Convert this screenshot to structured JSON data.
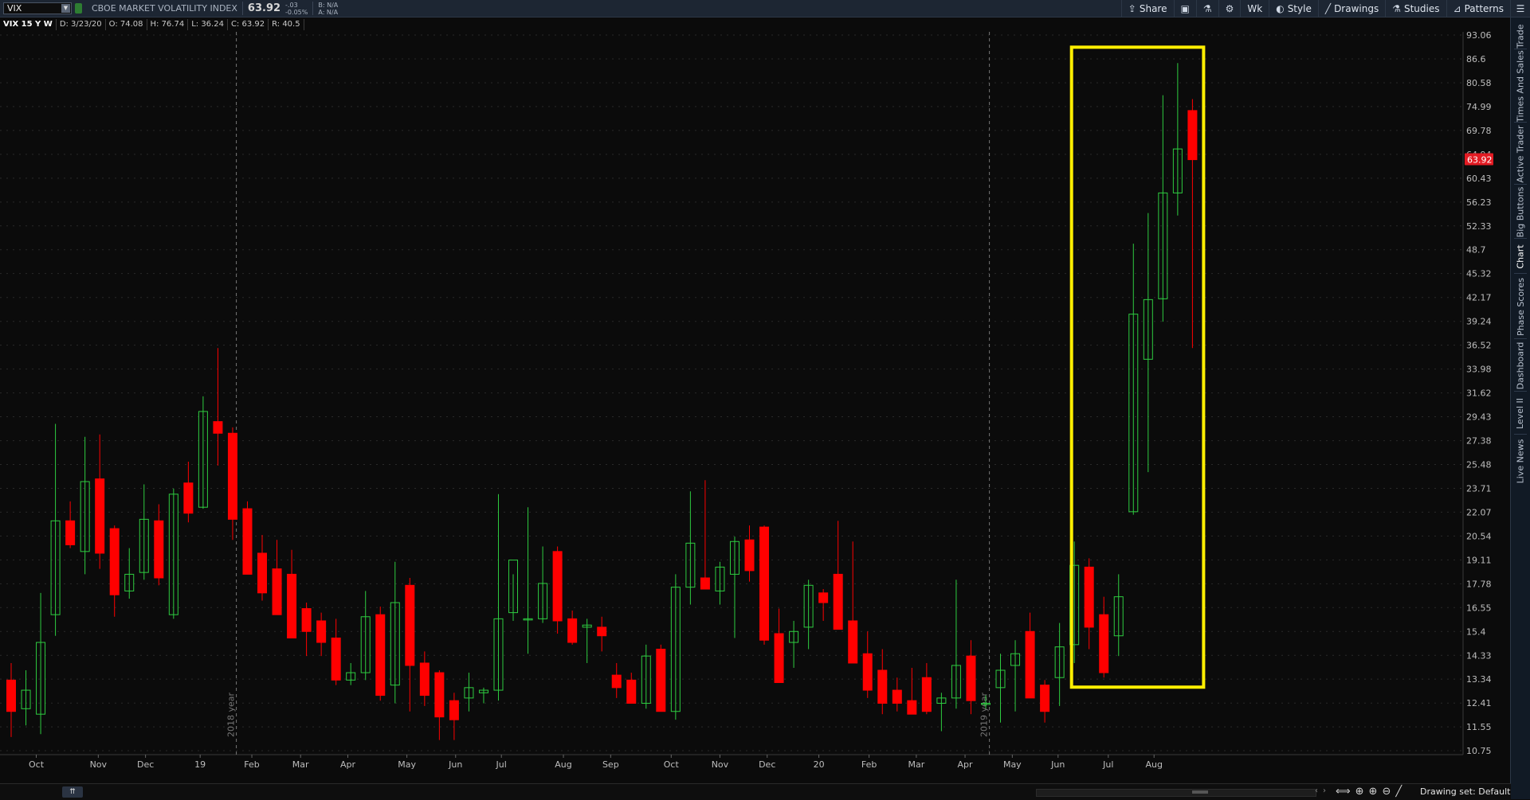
{
  "toolbar": {
    "symbol": "VIX",
    "description": "CBOE MARKET VOLATILITY INDEX",
    "last": "63.92",
    "change_top": "-.03",
    "change_bottom": "-0.05%",
    "bid": "B: N/A",
    "ask": "A: N/A",
    "share_label": "Share",
    "period_label": "Wk",
    "style_label": "Style",
    "drawings_label": "Drawings",
    "studies_label": "Studies",
    "patterns_label": "Patterns"
  },
  "info": {
    "symbol_period": "VIX 15 Y W",
    "date": "D: 3/23/20",
    "open": "O: 74.08",
    "high": "H: 76.74",
    "low": "L: 36.24",
    "close": "C: 63.92",
    "range": "R: 40.5"
  },
  "rail_tabs": [
    "Trade",
    "Times And Sales",
    "Active Trader",
    "Big Buttons",
    "Chart",
    "Phase Scores",
    "Dashboard",
    "Level II",
    "Live News"
  ],
  "bottom": {
    "drawing_set": "Drawing set: Default"
  },
  "colors": {
    "up": "#2ecc40",
    "down": "#ff0000",
    "highlight": "#ffee00",
    "price_tag": "#e31b23"
  },
  "chart_data": {
    "type": "candlestick",
    "period": "weekly",
    "ylim": [
      10.75,
      93.06
    ],
    "price_axis_labels": [
      "93.06",
      "86.6",
      "80.58",
      "74.99",
      "69.78",
      "64.94",
      "60.43",
      "56.23",
      "52.33",
      "48.7",
      "45.32",
      "42.17",
      "39.24",
      "36.52",
      "33.98",
      "31.62",
      "29.43",
      "27.38",
      "25.48",
      "23.71",
      "22.07",
      "20.54",
      "19.11",
      "17.78",
      "16.55",
      "15.4",
      "14.33",
      "13.34",
      "12.41",
      "11.55",
      "10.75"
    ],
    "current_price": "63.92",
    "x_labels": [
      "Oct",
      "Nov",
      "Dec",
      "19",
      "Feb",
      "Mar",
      "Apr",
      "May",
      "Jun",
      "Jul",
      "Aug",
      "Sep",
      "Oct",
      "Nov",
      "Dec",
      "20",
      "Feb",
      "Mar",
      "Apr",
      "May",
      "Jun",
      "Jul",
      "Aug"
    ],
    "year_separators": [
      {
        "after_index": 15,
        "label": "2018 year"
      },
      {
        "after_index": 66,
        "label": "2019 year"
      }
    ],
    "highlight_from_index": 73,
    "candles": [
      [
        13.3,
        14.0,
        11.2,
        12.1
      ],
      [
        12.2,
        13.7,
        11.6,
        12.9
      ],
      [
        12.0,
        17.3,
        11.3,
        14.9
      ],
      [
        16.2,
        28.8,
        15.2,
        21.5
      ],
      [
        21.5,
        22.8,
        19.8,
        20.0
      ],
      [
        19.6,
        27.7,
        18.3,
        24.2
      ],
      [
        24.4,
        27.9,
        18.6,
        19.5
      ],
      [
        21.0,
        21.2,
        16.1,
        17.2
      ],
      [
        17.4,
        19.8,
        17.0,
        18.3
      ],
      [
        18.4,
        24.0,
        18.0,
        21.6
      ],
      [
        21.5,
        22.6,
        17.7,
        18.1
      ],
      [
        16.2,
        23.7,
        16.0,
        23.3
      ],
      [
        24.1,
        25.7,
        21.4,
        22.0
      ],
      [
        22.4,
        31.3,
        22.3,
        29.9
      ],
      [
        29.0,
        36.2,
        25.4,
        28.0
      ],
      [
        28.0,
        28.5,
        20.3,
        21.6
      ],
      [
        22.3,
        22.8,
        18.8,
        18.3
      ],
      [
        19.5,
        20.6,
        16.9,
        17.3
      ],
      [
        18.6,
        20.3,
        16.9,
        16.2
      ],
      [
        18.3,
        19.7,
        15.3,
        15.1
      ],
      [
        16.5,
        16.8,
        14.3,
        15.4
      ],
      [
        15.9,
        16.3,
        14.3,
        14.9
      ],
      [
        15.1,
        16.0,
        13.1,
        13.3
      ],
      [
        13.3,
        14.0,
        13.1,
        13.6
      ],
      [
        13.6,
        17.4,
        13.3,
        16.1
      ],
      [
        16.2,
        16.6,
        12.5,
        12.7
      ],
      [
        13.1,
        19.0,
        12.4,
        16.8
      ],
      [
        17.7,
        18.1,
        12.1,
        13.9
      ],
      [
        14.0,
        14.5,
        12.3,
        12.7
      ],
      [
        13.6,
        13.7,
        11.1,
        11.9
      ],
      [
        12.5,
        12.8,
        11.1,
        11.8
      ],
      [
        12.6,
        13.6,
        12.1,
        13.0
      ],
      [
        12.8,
        13.0,
        12.4,
        12.9
      ],
      [
        12.9,
        23.3,
        12.5,
        16.0
      ],
      [
        16.3,
        18.3,
        15.9,
        19.1
      ],
      [
        16.0,
        22.4,
        14.4,
        16.0
      ],
      [
        16.0,
        19.9,
        15.8,
        17.8
      ],
      [
        19.6,
        19.9,
        15.3,
        15.9
      ],
      [
        16.0,
        16.4,
        14.8,
        14.9
      ],
      [
        15.6,
        16.0,
        14.0,
        15.7
      ],
      [
        15.6,
        16.1,
        14.5,
        15.2
      ],
      [
        13.5,
        14.0,
        12.6,
        13.0
      ],
      [
        13.3,
        13.6,
        12.5,
        12.4
      ],
      [
        12.4,
        14.8,
        12.2,
        14.3
      ],
      [
        14.6,
        14.8,
        12.8,
        12.1
      ],
      [
        12.1,
        18.3,
        11.8,
        17.6
      ],
      [
        17.6,
        23.5,
        16.7,
        20.1
      ],
      [
        18.1,
        24.3,
        17.5,
        17.5
      ],
      [
        17.4,
        19.0,
        16.7,
        18.7
      ],
      [
        18.3,
        20.5,
        15.1,
        20.2
      ],
      [
        20.3,
        21.2,
        17.9,
        18.5
      ],
      [
        21.1,
        21.2,
        14.8,
        15.0
      ],
      [
        15.3,
        16.5,
        13.3,
        13.2
      ],
      [
        14.9,
        15.9,
        13.8,
        15.4
      ],
      [
        15.6,
        18.0,
        14.6,
        17.7
      ],
      [
        17.3,
        17.5,
        15.9,
        16.8
      ],
      [
        18.3,
        21.5,
        16.3,
        15.5
      ],
      [
        15.9,
        20.2,
        14.0,
        14.0
      ],
      [
        14.4,
        15.4,
        12.6,
        12.9
      ],
      [
        13.7,
        14.6,
        12.0,
        12.4
      ],
      [
        12.9,
        13.4,
        12.1,
        12.4
      ],
      [
        12.5,
        13.8,
        12.2,
        12.0
      ],
      [
        13.4,
        14.0,
        12.0,
        12.1
      ],
      [
        12.4,
        12.8,
        11.4,
        12.6
      ],
      [
        12.6,
        18.0,
        12.2,
        13.9
      ],
      [
        14.3,
        15.0,
        12.0,
        12.5
      ],
      [
        12.4,
        12.7,
        12.2,
        12.4
      ],
      [
        13.0,
        14.4,
        11.7,
        13.7
      ],
      [
        13.9,
        15.0,
        12.1,
        14.4
      ],
      [
        15.4,
        16.3,
        12.6,
        12.6
      ],
      [
        13.1,
        13.3,
        11.7,
        12.1
      ],
      [
        13.4,
        15.8,
        12.3,
        14.7
      ],
      [
        14.8,
        20.2,
        14.0,
        18.8
      ],
      [
        18.7,
        19.2,
        14.6,
        15.6
      ],
      [
        16.2,
        17.1,
        13.4,
        13.6
      ],
      [
        15.2,
        18.3,
        14.3,
        17.1
      ],
      [
        22.1,
        49.6,
        21.9,
        40.1
      ],
      [
        35.0,
        54.4,
        24.9,
        41.9
      ],
      [
        42.0,
        77.6,
        39.2,
        57.8
      ],
      [
        57.8,
        85.5,
        54.0,
        66.0
      ],
      [
        74.1,
        76.7,
        36.2,
        63.9
      ]
    ]
  }
}
